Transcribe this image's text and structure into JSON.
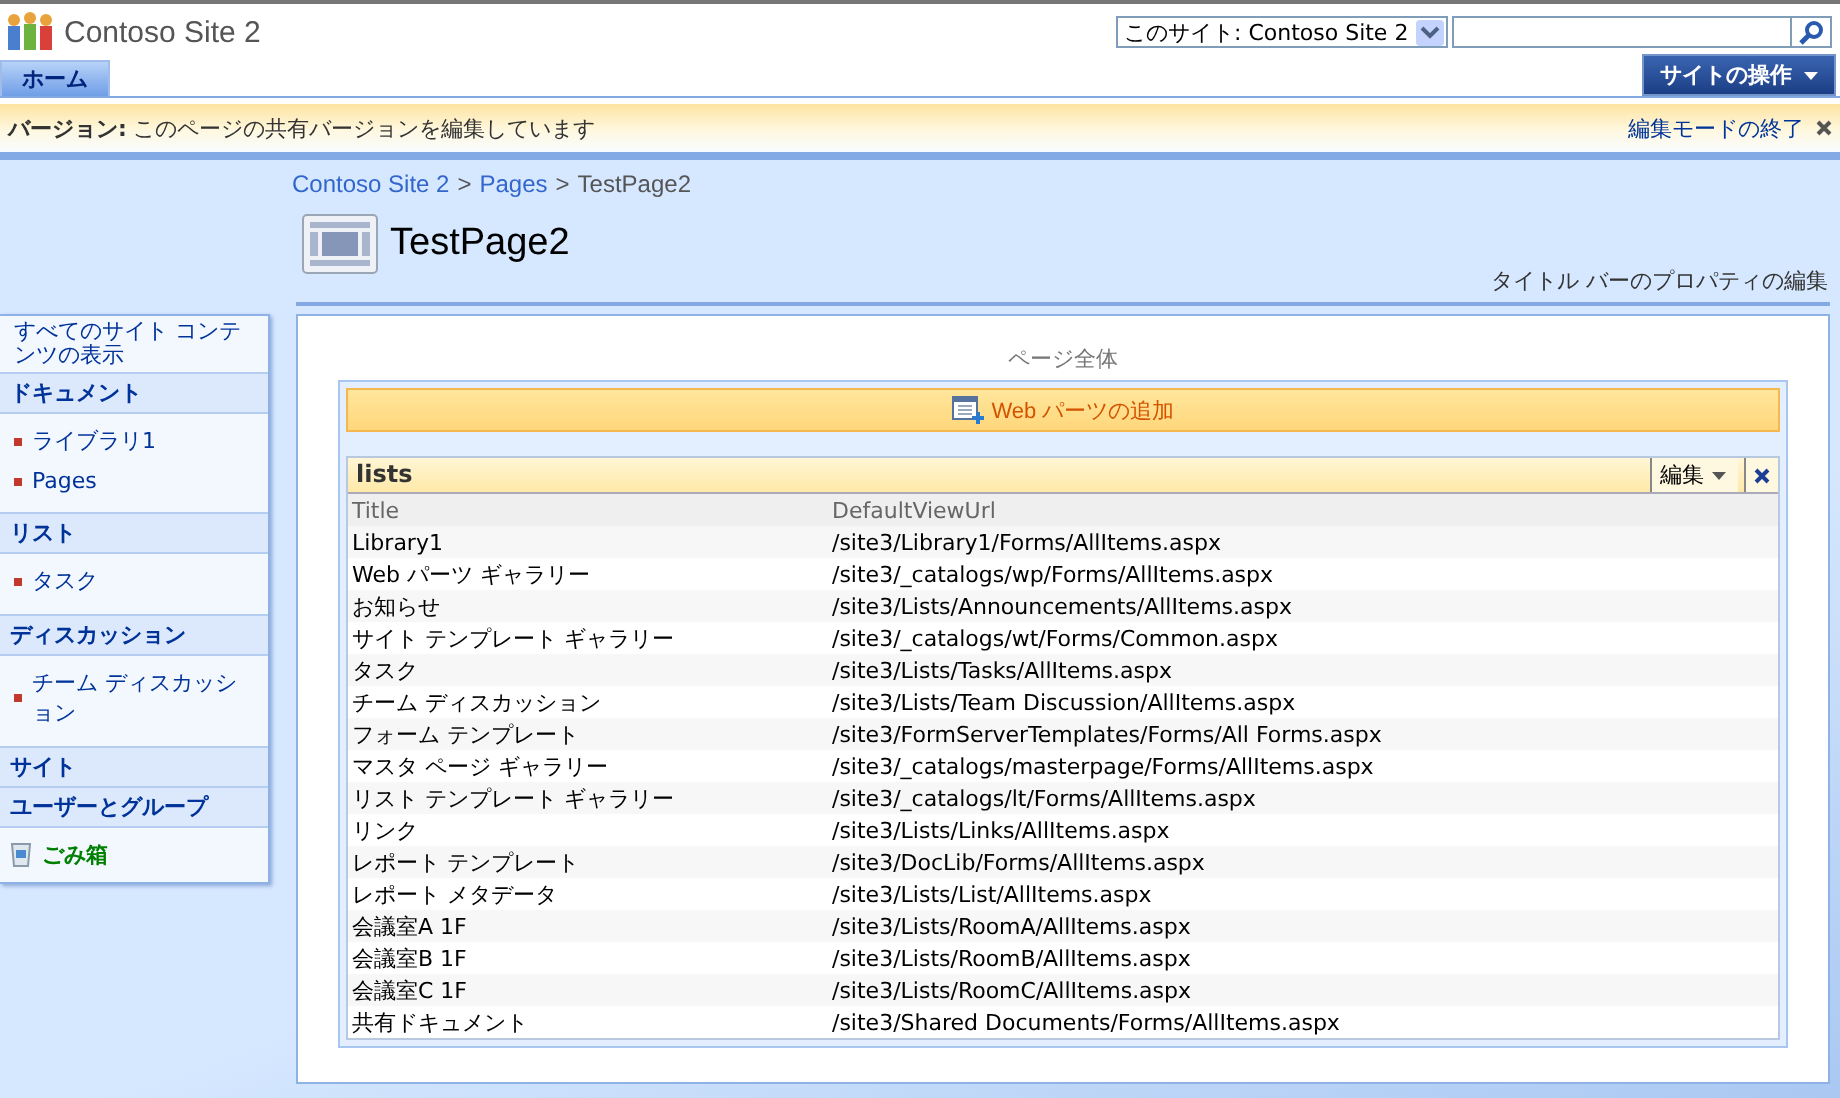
{
  "site": {
    "title": "Contoso Site 2"
  },
  "search": {
    "scope": "このサイト: Contoso Site 2"
  },
  "nav": {
    "tabs": [
      {
        "label": "ホーム",
        "selected": true
      }
    ],
    "site_actions": "サイトの操作"
  },
  "version_bar": {
    "label": "バージョン:",
    "message": "このページの共有バージョンを編集しています",
    "exit_link": "編集モードの終了"
  },
  "breadcrumb": {
    "items": [
      "Contoso Site 2",
      "Pages",
      "TestPage2"
    ],
    "separator": ">"
  },
  "page": {
    "title": "TestPage2",
    "title_bar_link": "タイトル バーのプロパティの編集"
  },
  "sidebar": {
    "view_all": "すべてのサイト コンテンツの表示",
    "sections": [
      {
        "heading": "ドキュメント",
        "items": [
          "ライブラリ1",
          "Pages"
        ]
      },
      {
        "heading": "リスト",
        "items": [
          "タスク"
        ]
      },
      {
        "heading": "ディスカッション",
        "items": [
          "チーム ディスカッション"
        ]
      },
      {
        "heading": "サイト"
      },
      {
        "heading": "ユーザーとグループ"
      }
    ],
    "recycle_bin": "ごみ箱"
  },
  "zone": {
    "title": "ページ全体",
    "add_web_part": "Web パーツの追加"
  },
  "web_part": {
    "title": "lists",
    "edit_menu": "編集",
    "table": {
      "columns": [
        "Title",
        "DefaultViewUrl"
      ],
      "rows": [
        [
          "Library1",
          "/site3/Library1/Forms/AllItems.aspx"
        ],
        [
          "Web パーツ ギャラリー",
          "/site3/_catalogs/wp/Forms/AllItems.aspx"
        ],
        [
          "お知らせ",
          "/site3/Lists/Announcements/AllItems.aspx"
        ],
        [
          "サイト テンプレート ギャラリー",
          "/site3/_catalogs/wt/Forms/Common.aspx"
        ],
        [
          "タスク",
          "/site3/Lists/Tasks/AllItems.aspx"
        ],
        [
          "チーム ディスカッション",
          "/site3/Lists/Team Discussion/AllItems.aspx"
        ],
        [
          "フォーム テンプレート",
          "/site3/FormServerTemplates/Forms/All Forms.aspx"
        ],
        [
          "マスタ ページ ギャラリー",
          "/site3/_catalogs/masterpage/Forms/AllItems.aspx"
        ],
        [
          "リスト テンプレート ギャラリー",
          "/site3/_catalogs/lt/Forms/AllItems.aspx"
        ],
        [
          "リンク",
          "/site3/Lists/Links/AllItems.aspx"
        ],
        [
          "レポート テンプレート",
          "/site3/DocLib/Forms/AllItems.aspx"
        ],
        [
          "レポート メタデータ",
          "/site3/Lists/List/AllItems.aspx"
        ],
        [
          "会議室A 1F",
          "/site3/Lists/RoomA/AllItems.aspx"
        ],
        [
          "会議室B 1F",
          "/site3/Lists/RoomB/AllItems.aspx"
        ],
        [
          "会議室C 1F",
          "/site3/Lists/RoomC/AllItems.aspx"
        ],
        [
          "共有ドキュメント",
          "/site3/Shared Documents/Forms/AllItems.aspx"
        ]
      ]
    }
  }
}
